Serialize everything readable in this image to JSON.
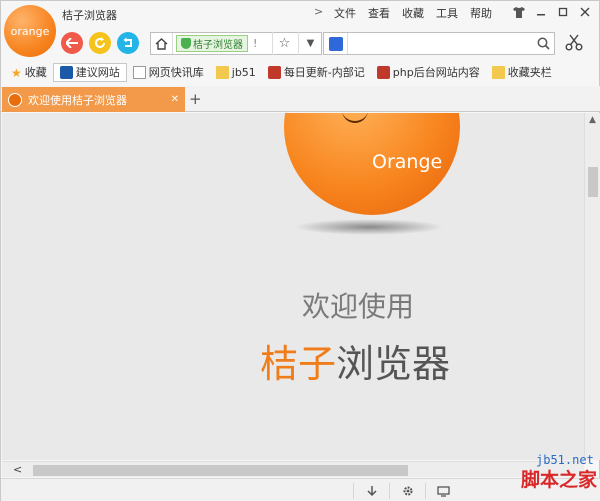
{
  "app": {
    "logo_text": "orange",
    "title": "桔子浏览器"
  },
  "menu": {
    "items": [
      "文件",
      "查看",
      "收藏",
      "工具",
      "帮助"
    ]
  },
  "window_controls": [
    "shirt-icon",
    "minimize-icon",
    "maximize-icon",
    "close-icon"
  ],
  "address_bar": {
    "secure_label": "桔子浏览器",
    "separator": "!"
  },
  "search": {
    "value": "",
    "placeholder": ""
  },
  "bookmarks": {
    "fav_label": "收藏",
    "items": [
      "建议网站",
      "网页快讯库",
      "jb51",
      "每日更新-内部记",
      "php后台网站内容",
      "收藏夹栏"
    ]
  },
  "tab": {
    "title": "欢迎使用桔子浏览器"
  },
  "content": {
    "brand": "Orange",
    "welcome": "欢迎使用",
    "name_highlight": "桔子",
    "name_rest": "浏览器"
  },
  "watermark": {
    "url": "jb51.net",
    "name": "脚本之家"
  },
  "colors": {
    "accent": "#f07d1a",
    "tab_bg": "#f39a4a",
    "back": "#f05a4a",
    "refresh": "#f5c31c",
    "restore": "#23b5e8"
  }
}
